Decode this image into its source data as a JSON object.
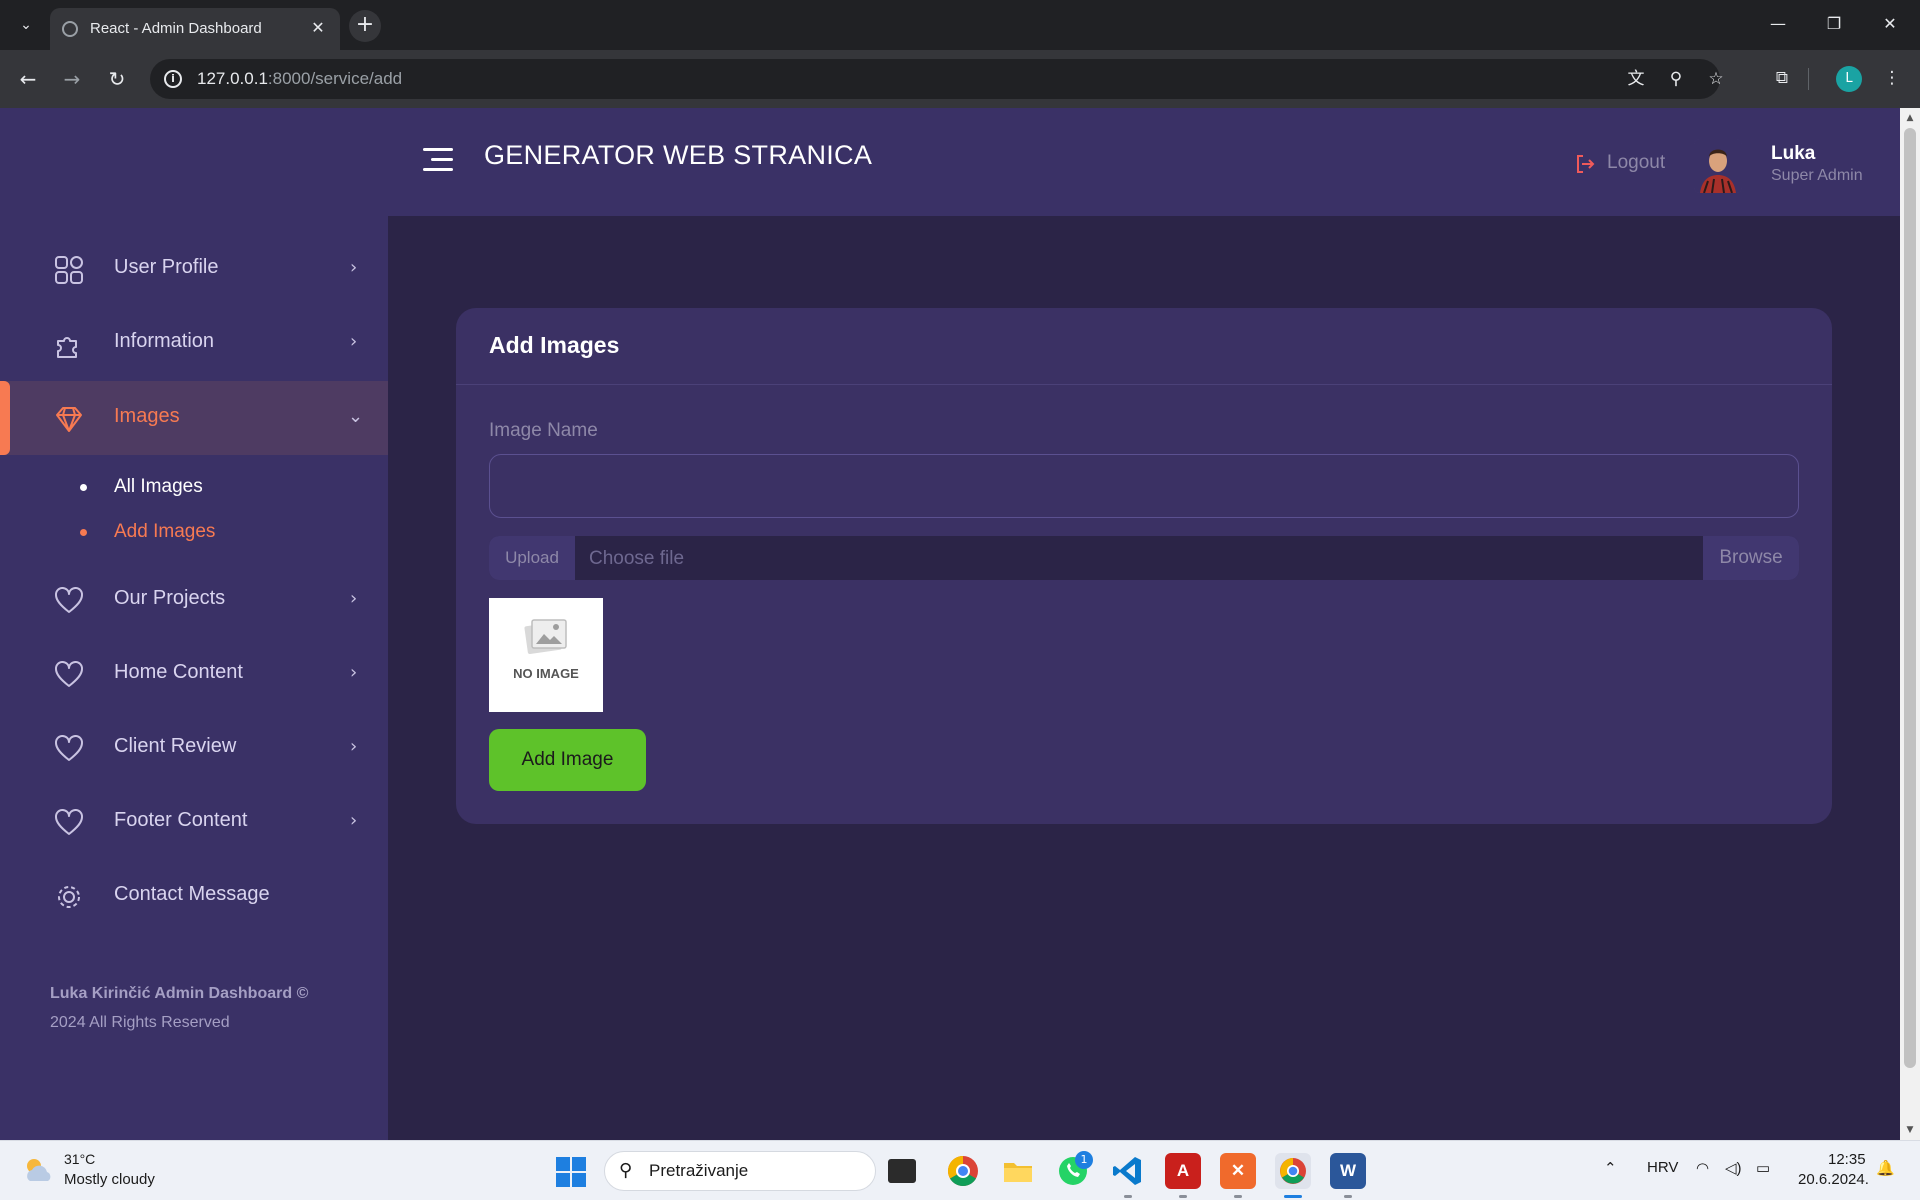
{
  "browser": {
    "tab_title": "React - Admin Dashboard",
    "url_host": "127.0.0.1",
    "url_rest": ":8000/service/add",
    "profile_initial": "L"
  },
  "header": {
    "brand": "GENERATOR WEB STRANICA",
    "logout_label": "Logout",
    "user_name": "Luka",
    "user_role": "Super Admin"
  },
  "sidebar": {
    "items": [
      {
        "label": "User Profile",
        "icon": "grid-icon",
        "state": "collapsed"
      },
      {
        "label": "Information",
        "icon": "puzzle-icon",
        "state": "collapsed"
      },
      {
        "label": "Images",
        "icon": "diamond-icon",
        "state": "expanded",
        "active": true
      },
      {
        "label": "Our Projects",
        "icon": "heart-icon",
        "state": "collapsed"
      },
      {
        "label": "Home Content",
        "icon": "heart-icon",
        "state": "collapsed"
      },
      {
        "label": "Client Review",
        "icon": "heart-icon",
        "state": "collapsed"
      },
      {
        "label": "Footer Content",
        "icon": "heart-icon",
        "state": "collapsed"
      },
      {
        "label": "Contact Message",
        "icon": "gear-icon"
      }
    ],
    "subitems": [
      {
        "label": "All Images"
      },
      {
        "label": "Add Images",
        "active": true
      }
    ],
    "footer_bold": "Luka Kirinčić Admin Dashboard ©",
    "footer_rest": "2024 All Rights Reserved"
  },
  "card": {
    "title": "Add Images",
    "image_name_label": "Image Name",
    "image_name_value": "",
    "upload_label": "Upload",
    "choose_placeholder": "Choose file",
    "browse_label": "Browse",
    "preview_text": "NO IMAGE",
    "submit_label": "Add Image"
  },
  "taskbar": {
    "temperature": "31°C",
    "weather": "Mostly cloudy",
    "search_placeholder": "Pretraživanje",
    "whatsapp_badge": "1",
    "language": "HRV",
    "time": "12:35",
    "date": "20.6.2024."
  },
  "colors": {
    "sidebar_bg": "#3a3166",
    "content_bg": "#2b2447",
    "accent": "#f77a52",
    "button_green": "#5ec22a"
  }
}
